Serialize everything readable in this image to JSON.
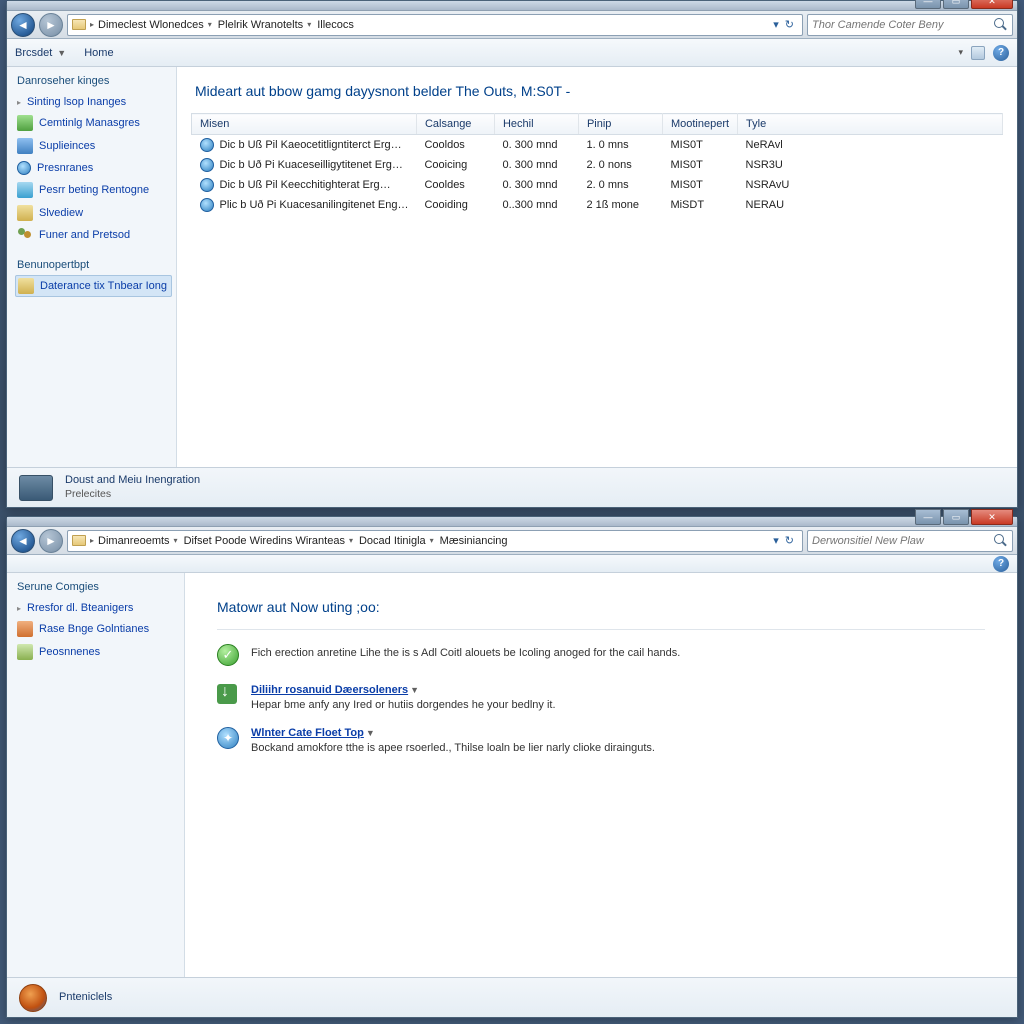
{
  "top_window": {
    "breadcrumb": [
      "Dimeclest Wlonedces",
      "Plelrik Wranotelts",
      "Illecocs"
    ],
    "search_placeholder": "Thor Camende Coter Beny",
    "toolbar": {
      "brand": "Brcsdet",
      "home": "Home"
    },
    "sidebar": {
      "header": "Danroseher kinges",
      "items": [
        "Sinting lsop Inanges",
        "Cemtinlg Manasgres",
        "Suplieinces",
        "Presnranes",
        "Pesrr beting Rentogne",
        "Slvediew",
        "Funer and Pretsod"
      ],
      "group_header": "Benunopertbpt",
      "group_item": "Daterance tix Tnbear Iong"
    },
    "heading": "Mideart aut bbow gamg dayysnont belder The Outs, M:S0T -",
    "columns": [
      "Misen",
      "Calsange",
      "Hechil",
      "Pinip",
      "Mootinepert",
      "Tyle"
    ],
    "rows": [
      {
        "name": "Dic b Uß Pil Kaeocetitligntiterct Erg…",
        "c1": "Cooldos",
        "c2": "0. 300 mnd",
        "c3": "1. 0 mns",
        "c4": "MIS0T",
        "c5": "NeRAvl"
      },
      {
        "name": "Dic b Uð Pi Kuaceseilligytitenet Erg…",
        "c1": "Cooicing",
        "c2": "0. 300 mnd",
        "c3": "2. 0 nons",
        "c4": "MIS0T",
        "c5": "NSR3U"
      },
      {
        "name": "Dic b Uß Pil Keecchitighterat Erg…",
        "c1": "Cooldes",
        "c2": "0. 300 mnd",
        "c3": "2. 0 mns",
        "c4": "MIS0T",
        "c5": "NSRAvU"
      },
      {
        "name": "Plic b Uð Pi Kuacesanilingitenet Eng…",
        "c1": "Cooiding",
        "c2": "0..300 mnd",
        "c3": "2 1ß mone",
        "c4": "MiSDT",
        "c5": "NERAU"
      }
    ],
    "status": {
      "line1": "Doust and Meiu Inengration",
      "line2": "Prelecites"
    }
  },
  "bot_window": {
    "breadcrumb": [
      "Dimanreoemts",
      "Difset Poode Wiredins Wiranteas",
      "Docad Itinigla",
      "Mæsiniancing"
    ],
    "search_placeholder": "Derwonsitiel New Plaw",
    "sidebar": {
      "header": "Serune Comgies",
      "items": [
        "Rresfor dl. Bteanigers",
        "Rase Bnge Golntianes",
        "Peosnnenes"
      ]
    },
    "heading": "Matowr aut Now uting ;oo:",
    "line1": "Fich erection anretine Lihe the is s Adl Coitl alouets be Icoling anoged for the cail hands.",
    "item2": {
      "link": "Diliihr rosanuid Dæersoleners",
      "desc": "Hepar bme anfy any Ired or hutiis dorgendes he your bedlny it."
    },
    "item3": {
      "link": "Wlnter Cate Floet Top",
      "desc": "Bockand amokfore tthe is apee rsoerled., Thilse loaln be lier narly clioke dirainguts."
    },
    "status": "Pnteniclels"
  }
}
